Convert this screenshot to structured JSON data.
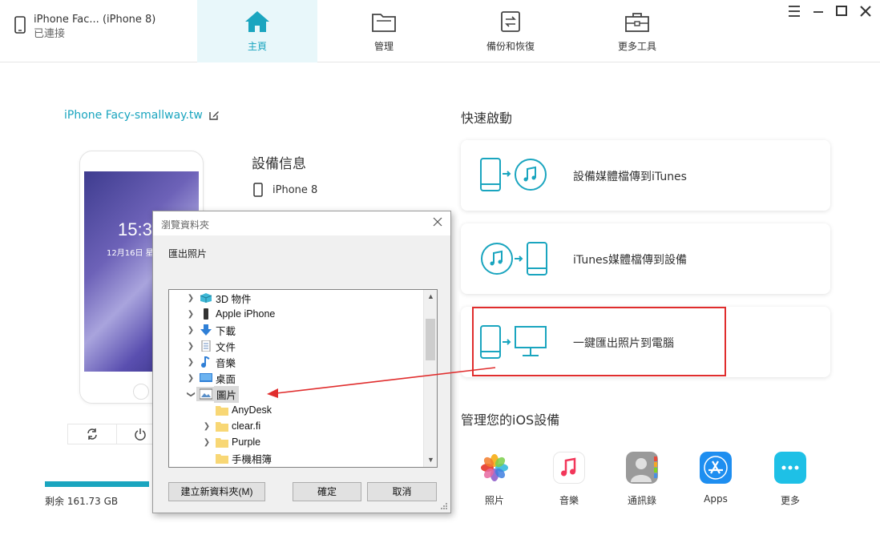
{
  "device": {
    "name": "iPhone Fac... (iPhone 8)",
    "status": "已連接"
  },
  "nav": [
    {
      "label": "主頁",
      "active": true
    },
    {
      "label": "管理",
      "active": false
    },
    {
      "label": "備份和恢復",
      "active": false
    },
    {
      "label": "更多工具",
      "active": false
    }
  ],
  "left": {
    "device_title": "iPhone Facy-smallway.tw",
    "phone_time": "15:37",
    "phone_date": "12月16日 星",
    "storage_text": "剩余 161.73 GB"
  },
  "info": {
    "title": "設備信息",
    "model": "iPhone 8"
  },
  "quick": {
    "title": "快速啟動",
    "cards": [
      {
        "label": "設備媒體檔傳到iTunes"
      },
      {
        "label": "iTunes媒體檔傳到設備"
      },
      {
        "label": "一鍵匯出照片到電腦"
      }
    ]
  },
  "manage": {
    "title": "管理您的iOS設備",
    "apps": [
      {
        "label": "照片"
      },
      {
        "label": "音樂"
      },
      {
        "label": "通訊錄"
      },
      {
        "label": "Apps"
      },
      {
        "label": "更多"
      }
    ]
  },
  "dialog": {
    "title": "瀏覽資料夾",
    "description": "匯出照片",
    "tree": [
      {
        "label": "3D 物件",
        "icon": "cube-icon",
        "expandable": true,
        "indent": 0
      },
      {
        "label": "Apple iPhone",
        "icon": "iphone-icon",
        "expandable": true,
        "indent": 0
      },
      {
        "label": "下載",
        "icon": "download-icon",
        "expandable": true,
        "indent": 0
      },
      {
        "label": "文件",
        "icon": "document-icon",
        "expandable": true,
        "indent": 0
      },
      {
        "label": "音樂",
        "icon": "music-note-icon",
        "expandable": true,
        "indent": 0
      },
      {
        "label": "桌面",
        "icon": "desktop-icon",
        "expandable": true,
        "indent": 0
      },
      {
        "label": "圖片",
        "icon": "pictures-icon",
        "expandable": false,
        "expanded": true,
        "selected": true,
        "indent": 0
      },
      {
        "label": "AnyDesk",
        "icon": "folder-icon",
        "expandable": false,
        "indent": 1
      },
      {
        "label": "clear.fi",
        "icon": "folder-icon",
        "expandable": true,
        "indent": 1
      },
      {
        "label": "Purple",
        "icon": "folder-icon",
        "expandable": true,
        "indent": 1
      },
      {
        "label": "手機相簿",
        "icon": "folder-icon",
        "expandable": false,
        "indent": 1
      }
    ],
    "btn_new_folder": "建立新資料夾(M)",
    "btn_ok": "確定",
    "btn_cancel": "取消"
  },
  "colors": {
    "accent": "#1aa5bf",
    "highlight": "#e02d2d"
  }
}
